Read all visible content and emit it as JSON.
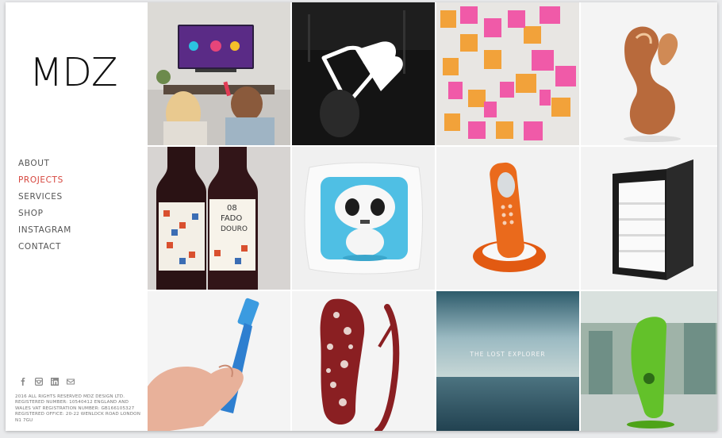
{
  "brand": {
    "logo_text": "MDZ"
  },
  "nav": {
    "items": [
      {
        "label": "ABOUT",
        "active": false
      },
      {
        "label": "PROJECTS",
        "active": true
      },
      {
        "label": "SERVICES",
        "active": false
      },
      {
        "label": "SHOP",
        "active": false
      },
      {
        "label": "INSTAGRAM",
        "active": false
      },
      {
        "label": "CONTACT",
        "active": false
      }
    ]
  },
  "social": [
    "facebook-icon",
    "instagram-icon",
    "linkedin-icon",
    "email-icon"
  ],
  "footer": {
    "legal_text": "2016 All rights reserved MDZ Design Ltd. Registered Number: 10540412 England and Wales VAT Registration Number: GB166105327 Registered Office: 20-22 Wenlock Road London N1 7GU"
  },
  "tiles": {
    "wine_label_1": "08",
    "wine_label_2": "FADO",
    "wine_label_3": "DOURO",
    "explorer_title": "THE LOST EXPLORER"
  },
  "colors": {
    "accent": "#d6453d",
    "nav_text": "#555555",
    "logo": "#111111"
  }
}
